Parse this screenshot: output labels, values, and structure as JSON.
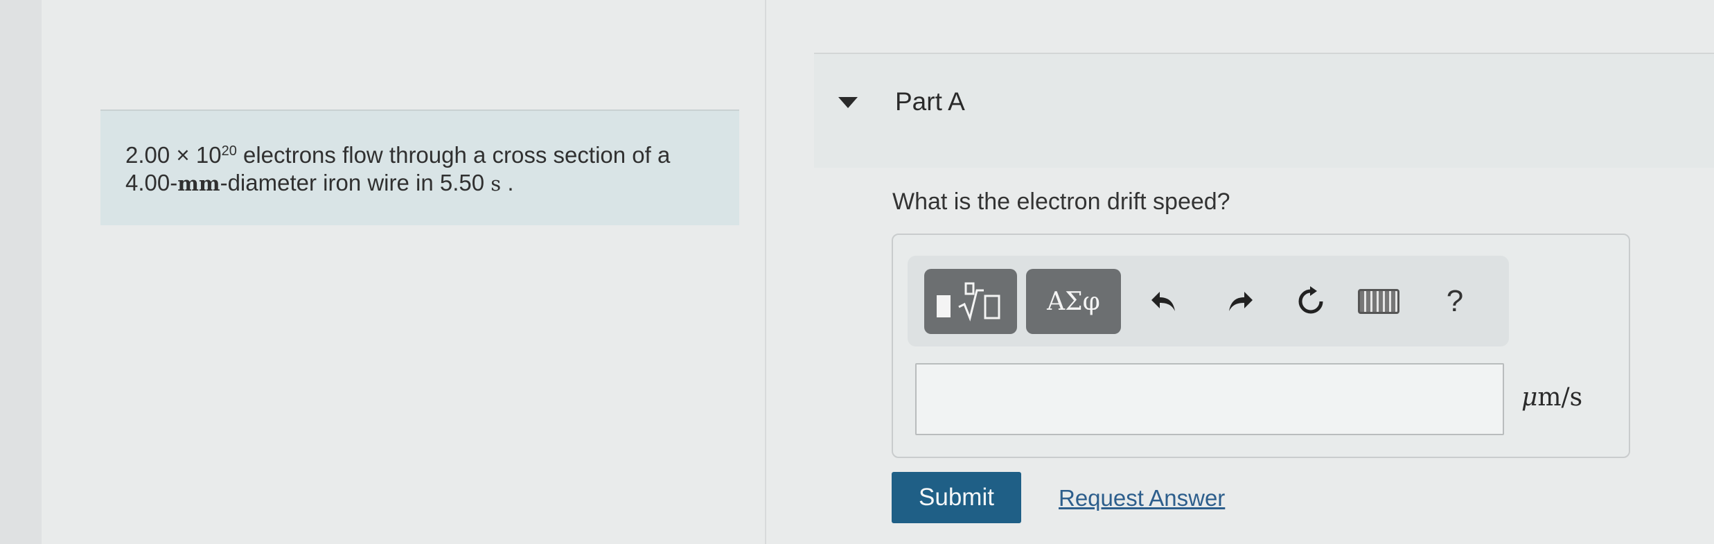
{
  "problem": {
    "coef": "2.00",
    "times": "×",
    "base": "10",
    "exponent": "20",
    "line1_rest": "electrons flow through a cross section of a",
    "line2_num": "4.00-",
    "line2_unit": "mm",
    "line2_rest": "-diameter iron wire in ",
    "time_value": "5.50",
    "time_unit": "s",
    "period": "."
  },
  "part": {
    "title": "Part A",
    "question": "What is the electron drift speed?"
  },
  "toolbar": {
    "template_icon": "sqrt-template-icon",
    "greek_label": "ΑΣφ",
    "undo_icon": "undo-icon",
    "redo_icon": "redo-icon",
    "reset_icon": "reset-icon",
    "keyboard_icon": "keyboard-icon",
    "help_label": "?"
  },
  "answer": {
    "value": "",
    "unit_mu": "μ",
    "unit_rest": "m/s"
  },
  "actions": {
    "submit_label": "Submit",
    "request_label": "Request Answer"
  },
  "colors": {
    "submit_bg": "#1f5f86",
    "link": "#2d5e8c",
    "problem_bg": "#d9e4e6"
  }
}
